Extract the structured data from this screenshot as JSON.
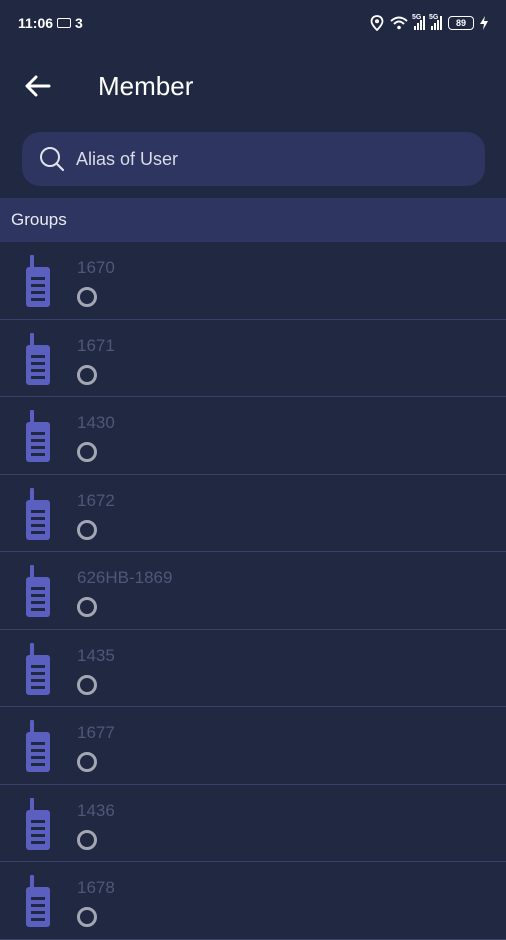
{
  "status_bar": {
    "time": "11:06",
    "sim_count": "3",
    "signal_1_label": "5G",
    "signal_2_label": "5G",
    "battery": "89"
  },
  "header": {
    "title": "Member"
  },
  "search": {
    "placeholder": "Alias of User"
  },
  "section": {
    "title": "Groups"
  },
  "members": [
    {
      "name": "1670"
    },
    {
      "name": "1671"
    },
    {
      "name": "1430"
    },
    {
      "name": "1672"
    },
    {
      "name": "626HB-1869"
    },
    {
      "name": "1435"
    },
    {
      "name": "1677"
    },
    {
      "name": "1436"
    },
    {
      "name": "1678"
    }
  ],
  "colors": {
    "background": "#212842",
    "panel": "#2d3560",
    "icon": "#5b5fc0",
    "divider": "#39416a",
    "muted_text": "#4f577a"
  }
}
